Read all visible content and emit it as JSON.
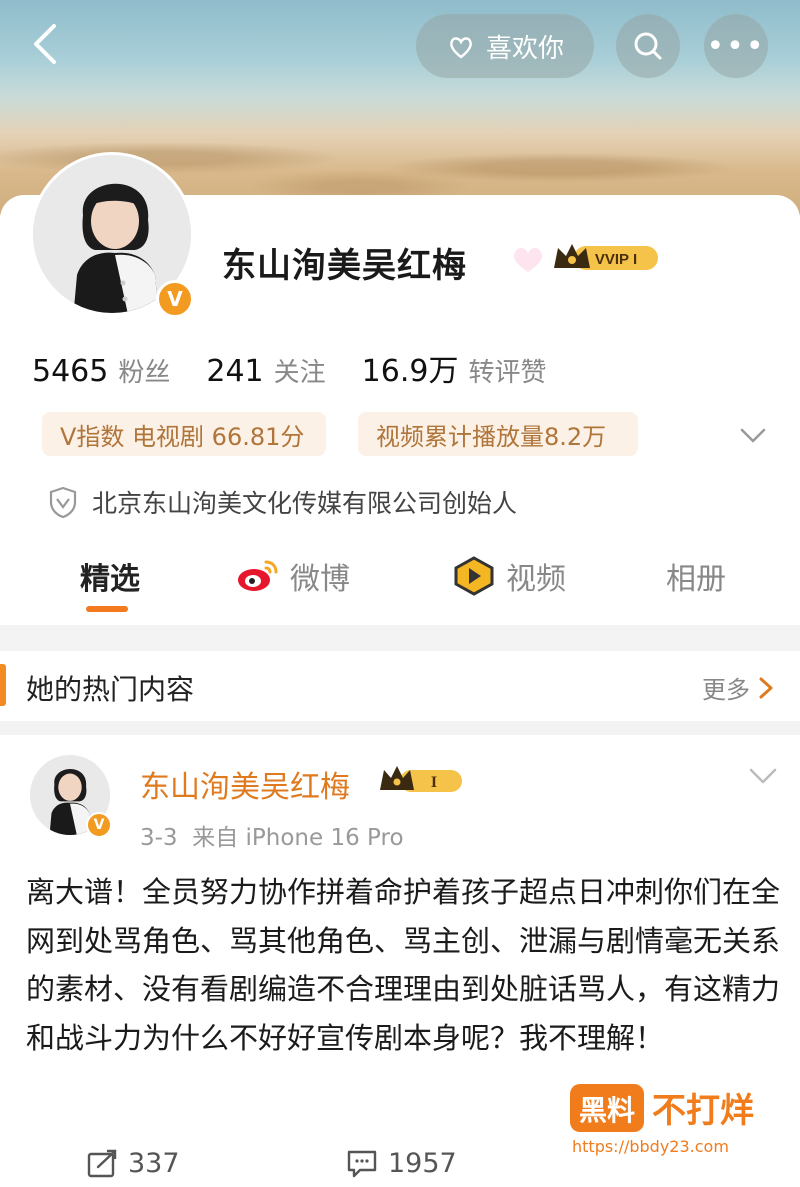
{
  "header": {
    "back_icon": "chevron-left-icon",
    "like_label": "喜欢你",
    "search_icon": "search-icon",
    "more_label": "•••"
  },
  "profile": {
    "name": "东山洵美吴红梅",
    "vip_label": "VVIP I",
    "verified_badge": "V",
    "stats": [
      {
        "value": "5465",
        "label": "粉丝"
      },
      {
        "value": "241",
        "label": "关注"
      },
      {
        "value": "16.9万",
        "label": "转评赞"
      }
    ],
    "tags": [
      {
        "label": "V指数 电视剧 66.81分"
      },
      {
        "label": "视频累计播放量8.2万"
      }
    ],
    "certification": "北京东山洵美文化传媒有限公司创始人"
  },
  "tabs": [
    {
      "label": "精选",
      "active": true
    },
    {
      "label": "微博",
      "active": false
    },
    {
      "label": "视频",
      "active": false
    },
    {
      "label": "相册",
      "active": false
    }
  ],
  "hot_section": {
    "title": "她的热门内容",
    "more": "更多"
  },
  "post": {
    "author": "东山洵美吴红梅",
    "vip_label": "I",
    "meta": "3-3  来自 iPhone 16 Pro",
    "text": "离大谱！全员努力协作拼着命护着孩子超点日冲刺你们在全网到处骂角色、骂其他角色、骂主创、泄漏与剧情毫无关系的素材、没有看剧编造不合理理由到处脏话骂人，有这精力和战斗力为什么不好好宣传剧本身呢？我不理解！",
    "reposts": "337",
    "comments": "1957"
  },
  "watermark": {
    "brand_a": "黑料",
    "brand_b": "不打烊",
    "url": "https://bbdy23.com"
  },
  "colors": {
    "accent": "#f47a20",
    "tag_bg": "#fbf1e6",
    "tag_text": "#b0753a",
    "author_name": "#e07a1f"
  }
}
